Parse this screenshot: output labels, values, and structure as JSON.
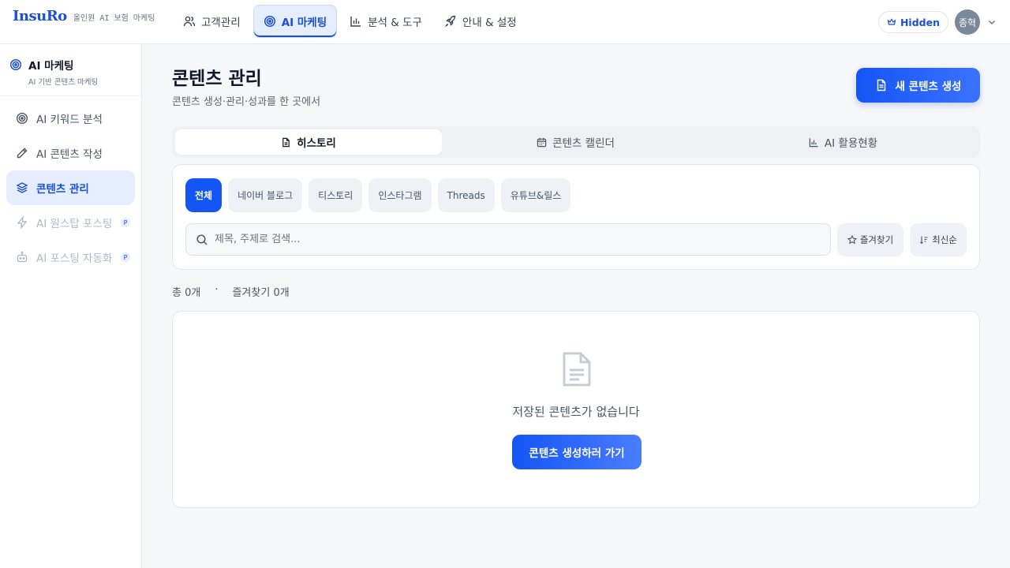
{
  "brand": {
    "name": "InsuRo",
    "tagline": "올인원 AI 보험 마케팅"
  },
  "topnav": [
    {
      "label": "고객관리",
      "icon": "users-icon"
    },
    {
      "label": "AI 마케팅",
      "icon": "target-icon",
      "active": true
    },
    {
      "label": "분석 & 도구",
      "icon": "bar-chart-icon"
    },
    {
      "label": "안내 & 설정",
      "icon": "rocket-icon"
    }
  ],
  "user": {
    "plan_label": "Hidden",
    "avatar_text": "종혁"
  },
  "sidebar": {
    "title": "AI 마케팅",
    "subtitle": "AI 기반 콘텐츠 마케팅",
    "items": [
      {
        "label": "AI 키워드 분석",
        "icon": "target-icon"
      },
      {
        "label": "AI 콘텐츠 작성",
        "icon": "pencil-icon"
      },
      {
        "label": "콘텐츠 관리",
        "icon": "layers-icon",
        "active": true
      },
      {
        "label": "AI 원스탑 포스팅",
        "icon": "lightning-icon",
        "disabled": true,
        "badge": "P"
      },
      {
        "label": "AI 포스팅 자동화",
        "icon": "bot-icon",
        "disabled": true,
        "badge": "P"
      }
    ]
  },
  "page": {
    "title": "콘텐츠 관리",
    "subtitle": "콘텐츠 생성·관리·성과를 한 곳에서",
    "new_button": "새 콘텐츠 생성"
  },
  "tabs": [
    {
      "label": "히스토리",
      "icon": "file-icon",
      "active": true
    },
    {
      "label": "콘텐츠 캘린더",
      "icon": "calendar-icon"
    },
    {
      "label": "AI 활용현황",
      "icon": "bar-chart-icon"
    }
  ],
  "filters": {
    "chips": [
      "전체",
      "네이버 블로그",
      "티스토리",
      "인스타그램",
      "Threads",
      "유튜브&릴스"
    ],
    "active_chip": "전체",
    "search_placeholder": "제목, 주제로 검색...",
    "favorites_label": "즐겨찾기",
    "sort_label": "최신순"
  },
  "counts": {
    "total": "총 0개",
    "separator": "·",
    "favorites": "즐겨찾기 0개"
  },
  "empty": {
    "message": "저장된 콘텐츠가 없습니다",
    "cta": "콘텐츠 생성하러 가기"
  },
  "colors": {
    "accent": "#1455f5",
    "accent_light": "#e5edff",
    "disabled": "#b3b9c4"
  }
}
